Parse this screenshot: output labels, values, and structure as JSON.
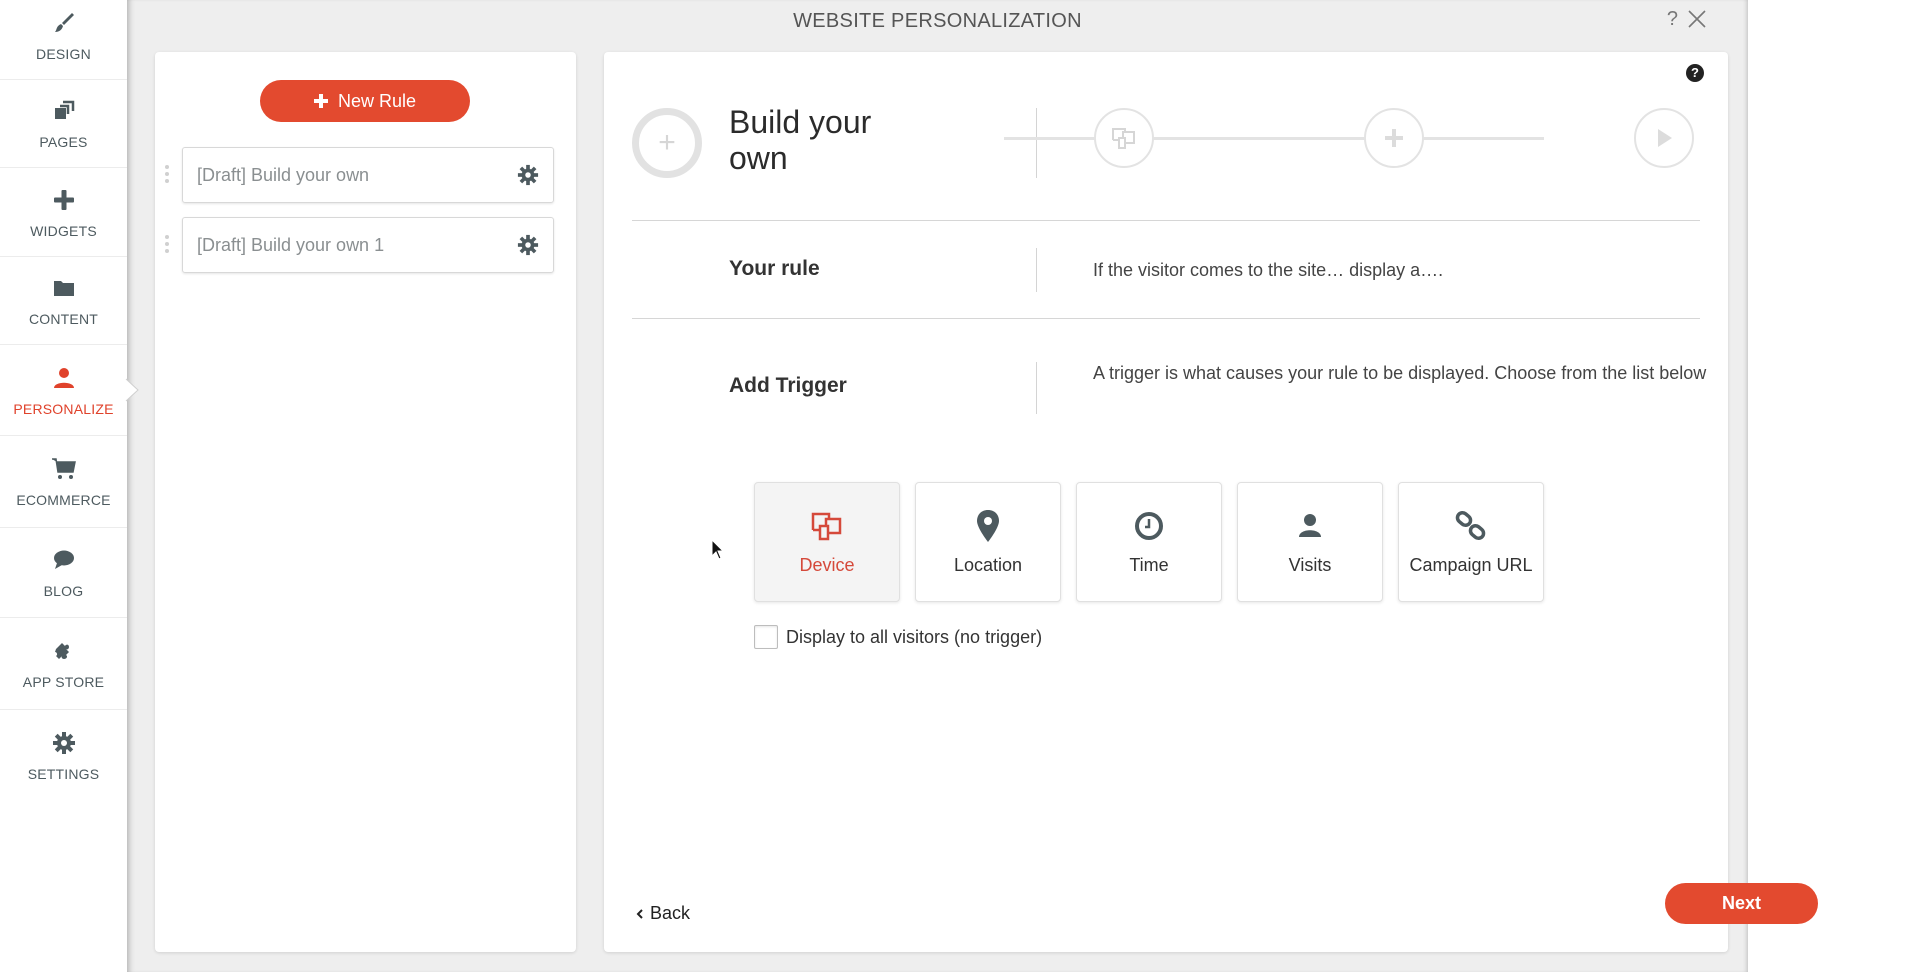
{
  "sidebar": {
    "items": [
      {
        "label": "DESIGN",
        "icon": "brush-icon",
        "active": false
      },
      {
        "label": "PAGES",
        "icon": "pages-icon",
        "active": false
      },
      {
        "label": "WIDGETS",
        "icon": "plus-icon",
        "active": false
      },
      {
        "label": "CONTENT",
        "icon": "folder-icon",
        "active": false
      },
      {
        "label": "PERSONALIZE",
        "icon": "person-icon",
        "active": true
      },
      {
        "label": "ECOMMERCE",
        "icon": "cart-icon",
        "active": false
      },
      {
        "label": "BLOG",
        "icon": "speech-bubble-icon",
        "active": false
      },
      {
        "label": "APP STORE",
        "icon": "puzzle-icon",
        "active": false
      },
      {
        "label": "SETTINGS",
        "icon": "gear-icon",
        "active": false
      }
    ]
  },
  "modal": {
    "title": "WEBSITE PERSONALIZATION",
    "help_label": "?",
    "close_icon": "close-icon"
  },
  "rules_panel": {
    "new_rule_label": "New Rule",
    "rules": [
      {
        "label": "[Draft] Build your own"
      },
      {
        "label": "[Draft] Build your own 1"
      }
    ]
  },
  "editor": {
    "help_label": "?",
    "heading": "Build your own",
    "steps": [
      "device-icon",
      "plus-icon",
      "play-icon"
    ],
    "your_rule_label": "Your rule",
    "your_rule_text": "If the visitor comes to the site… display a….",
    "add_trigger_label": "Add Trigger",
    "add_trigger_text": "A trigger is what causes your rule to be displayed. Choose from the list below",
    "triggers": [
      {
        "label": "Device",
        "icon": "device-icon",
        "selected": true
      },
      {
        "label": "Location",
        "icon": "location-pin-icon",
        "selected": false
      },
      {
        "label": "Time",
        "icon": "clock-icon",
        "selected": false
      },
      {
        "label": "Visits",
        "icon": "person-icon",
        "selected": false
      },
      {
        "label": "Campaign URL",
        "icon": "link-icon",
        "selected": false
      }
    ],
    "no_trigger_checkbox": {
      "label": "Display to all visitors (no trigger)",
      "checked": false
    },
    "back_label": "Back",
    "next_label": "Next"
  },
  "colors": {
    "accent": "#e34a2f",
    "icon_gray": "#4d5a5f",
    "modal_bg": "#eeeeee"
  }
}
